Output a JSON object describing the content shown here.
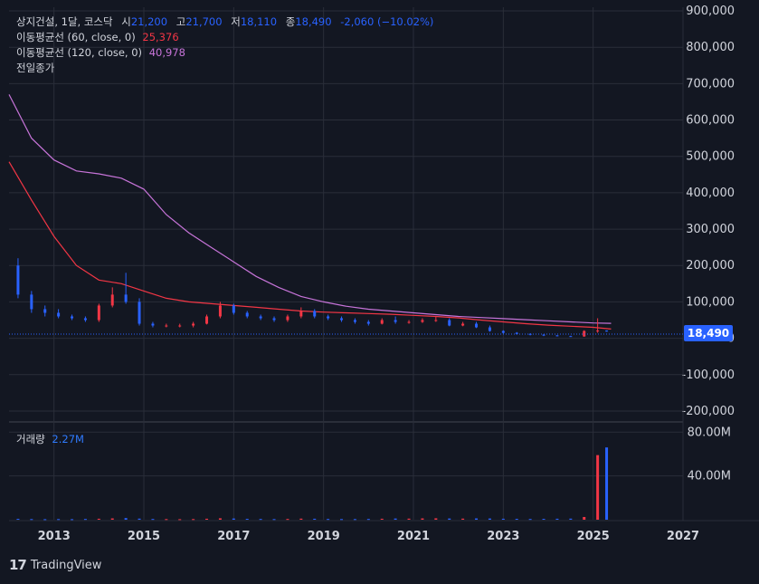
{
  "legend": {
    "symbol_line": "상지건설, 1달, 코스닥",
    "open_label": "시",
    "open_value": "21,200",
    "high_label": "고",
    "high_value": "21,700",
    "low_label": "저",
    "low_value": "18,110",
    "close_label": "종",
    "close_value": "18,490",
    "change": "-2,060 (−10.02%)",
    "ma60_label": "이동평균선 (60, close, 0)",
    "ma60_value": "25,376",
    "ma120_label": "이동평균선 (120, close, 0)",
    "ma120_value": "40,978",
    "prev_close_label": "전일종가"
  },
  "volume_legend": {
    "label": "거래량",
    "value": "2.27M"
  },
  "last_price_tag": "18,490",
  "footer": {
    "logo_text": "TradingView"
  },
  "colors": {
    "background": "#131722",
    "up": "#f23645",
    "down": "#2962ff",
    "ma60": "#f23645",
    "ma120": "#c774d9",
    "grid": "#2a2e39",
    "text": "#d1d4dc"
  },
  "chart_data": {
    "type": "line",
    "price_axis": {
      "ticks": [
        "900,000",
        "800,000",
        "700,000",
        "600,000",
        "500,000",
        "400,000",
        "300,000",
        "200,000",
        "100,000",
        "0",
        "-100,000",
        "-200,000"
      ],
      "tick_values": [
        900000,
        800000,
        700000,
        600000,
        500000,
        400000,
        300000,
        200000,
        100000,
        0,
        -100000,
        -200000
      ],
      "ylim": [
        -230000,
        910000
      ]
    },
    "volume_axis": {
      "ticks": [
        "80.00M",
        "40.00M"
      ],
      "tick_values": [
        80,
        40
      ],
      "unit": "M"
    },
    "x_axis": {
      "ticks": [
        "2013",
        "2015",
        "2017",
        "2019",
        "2021",
        "2023",
        "2025",
        "2027"
      ],
      "tick_years": [
        2013,
        2015,
        2017,
        2019,
        2021,
        2023,
        2025,
        2027
      ],
      "xlim": [
        2012.0,
        2027.0
      ]
    },
    "series": [
      {
        "name": "이동평균선 (60, close, 0)",
        "x": [
          2012.0,
          2012.5,
          2013.0,
          2013.5,
          2014.0,
          2014.5,
          2015.0,
          2015.5,
          2016.0,
          2016.5,
          2017.0,
          2017.5,
          2018.0,
          2018.5,
          2019.0,
          2019.5,
          2020.0,
          2020.5,
          2021.0,
          2021.5,
          2022.0,
          2022.5,
          2023.0,
          2023.5,
          2024.0,
          2024.5,
          2025.0,
          2025.4
        ],
        "values": [
          485000,
          380000,
          280000,
          200000,
          160000,
          150000,
          130000,
          110000,
          100000,
          95000,
          90000,
          85000,
          80000,
          75000,
          72000,
          70000,
          68000,
          66000,
          63000,
          60000,
          56000,
          50000,
          45000,
          40000,
          36000,
          33000,
          30000,
          25376
        ]
      },
      {
        "name": "이동평균선 (120, close, 0)",
        "x": [
          2012.0,
          2012.5,
          2013.0,
          2013.5,
          2014.0,
          2014.5,
          2015.0,
          2015.5,
          2016.0,
          2016.5,
          2017.0,
          2017.5,
          2018.0,
          2018.5,
          2019.0,
          2019.5,
          2020.0,
          2020.5,
          2021.0,
          2021.5,
          2022.0,
          2022.5,
          2023.0,
          2023.5,
          2024.0,
          2024.5,
          2025.0,
          2025.4
        ],
        "values": [
          670000,
          550000,
          490000,
          460000,
          452000,
          440000,
          410000,
          340000,
          290000,
          250000,
          210000,
          170000,
          140000,
          115000,
          100000,
          88000,
          80000,
          75000,
          70000,
          65000,
          60000,
          57000,
          54000,
          51000,
          48000,
          45000,
          42000,
          40978
        ]
      },
      {
        "name": "candles",
        "x": [
          2012.2,
          2012.5,
          2012.8,
          2013.1,
          2013.4,
          2013.7,
          2014.0,
          2014.3,
          2014.6,
          2014.9,
          2015.2,
          2015.5,
          2015.8,
          2016.1,
          2016.4,
          2016.7,
          2017.0,
          2017.3,
          2017.6,
          2017.9,
          2018.2,
          2018.5,
          2018.8,
          2019.1,
          2019.4,
          2019.7,
          2020.0,
          2020.3,
          2020.6,
          2020.9,
          2021.2,
          2021.5,
          2021.8,
          2022.1,
          2022.4,
          2022.7,
          2023.0,
          2023.3,
          2023.6,
          2023.9,
          2024.2,
          2024.5,
          2024.8,
          2025.1,
          2025.3
        ],
        "open": [
          200000,
          120000,
          80000,
          70000,
          60000,
          55000,
          50000,
          90000,
          120000,
          100000,
          40000,
          35000,
          35000,
          35000,
          40000,
          60000,
          90000,
          70000,
          60000,
          55000,
          50000,
          60000,
          75000,
          60000,
          55000,
          50000,
          45000,
          40000,
          50000,
          45000,
          45000,
          50000,
          50000,
          35000,
          40000,
          30000,
          20000,
          15000,
          12000,
          10000,
          8000,
          6000,
          5000,
          20000,
          21200
        ],
        "close": [
          120000,
          80000,
          70000,
          60000,
          55000,
          50000,
          90000,
          120000,
          100000,
          40000,
          35000,
          35000,
          35000,
          40000,
          60000,
          90000,
          70000,
          60000,
          55000,
          50000,
          60000,
          75000,
          60000,
          55000,
          50000,
          45000,
          40000,
          50000,
          45000,
          45000,
          50000,
          50000,
          35000,
          40000,
          30000,
          20000,
          15000,
          12000,
          10000,
          8000,
          6000,
          5000,
          20000,
          21200,
          18490
        ],
        "high": [
          220000,
          130000,
          90000,
          80000,
          65000,
          60000,
          95000,
          140000,
          180000,
          110000,
          45000,
          40000,
          40000,
          45000,
          65000,
          100000,
          95000,
          75000,
          65000,
          60000,
          65000,
          85000,
          80000,
          65000,
          60000,
          55000,
          50000,
          55000,
          60000,
          50000,
          55000,
          60000,
          55000,
          45000,
          45000,
          35000,
          22000,
          17000,
          14000,
          11000,
          9000,
          7000,
          22000,
          55000,
          21700
        ],
        "low": [
          110000,
          70000,
          60000,
          55000,
          50000,
          45000,
          45000,
          85000,
          95000,
          35000,
          30000,
          30000,
          30000,
          30000,
          38000,
          55000,
          65000,
          55000,
          50000,
          45000,
          45000,
          55000,
          55000,
          50000,
          45000,
          40000,
          35000,
          38000,
          40000,
          40000,
          42000,
          45000,
          33000,
          33000,
          28000,
          18000,
          13000,
          10000,
          8000,
          6000,
          5000,
          4000,
          4000,
          15000,
          18110
        ]
      },
      {
        "name": "거래량",
        "x": [
          2012.2,
          2012.5,
          2012.8,
          2013.1,
          2013.4,
          2013.7,
          2014.0,
          2014.3,
          2014.6,
          2014.9,
          2015.2,
          2015.5,
          2015.8,
          2016.1,
          2016.4,
          2016.7,
          2017.0,
          2017.3,
          2017.6,
          2017.9,
          2018.2,
          2018.5,
          2018.8,
          2019.1,
          2019.4,
          2019.7,
          2020.0,
          2020.3,
          2020.6,
          2020.9,
          2021.2,
          2021.5,
          2021.8,
          2022.1,
          2022.4,
          2022.7,
          2023.0,
          2023.3,
          2023.6,
          2023.9,
          2024.2,
          2024.5,
          2024.8,
          2025.1,
          2025.3
        ],
        "values": [
          0.8,
          0.6,
          0.5,
          0.6,
          0.5,
          0.7,
          0.9,
          1.2,
          1.5,
          1.0,
          0.7,
          0.6,
          0.5,
          0.6,
          0.9,
          1.3,
          1.1,
          0.8,
          0.7,
          0.6,
          0.7,
          1.0,
          0.9,
          0.7,
          0.6,
          0.6,
          0.7,
          0.9,
          1.1,
          1.0,
          1.2,
          1.3,
          1.1,
          1.0,
          1.2,
          1.1,
          0.9,
          0.8,
          0.7,
          0.8,
          0.9,
          1.0,
          2.5,
          59.0,
          66.0
        ]
      }
    ]
  }
}
